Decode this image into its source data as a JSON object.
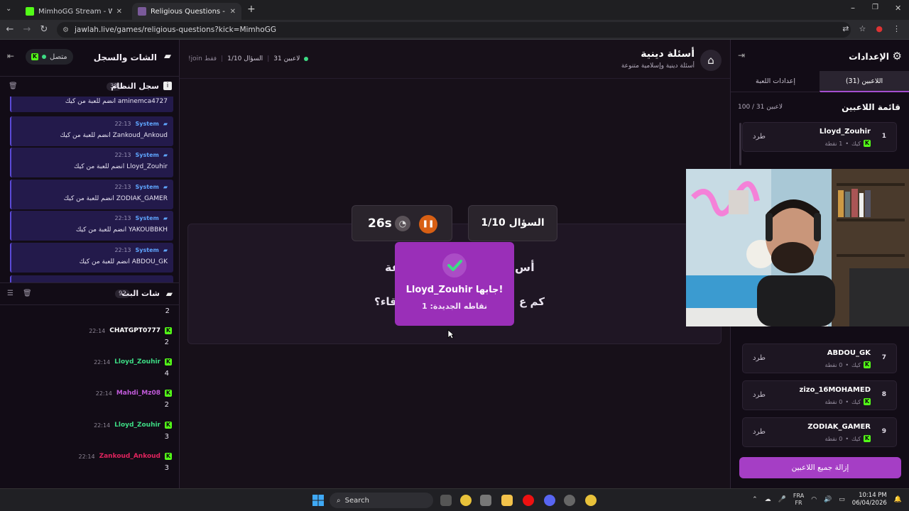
{
  "browser": {
    "tabs": [
      {
        "title": "MimhoGG Stream - Watch Live",
        "active": false
      },
      {
        "title": "Religious Questions - أسئلة دينية",
        "active": true
      }
    ],
    "url": "jawlah.live/games/religious-questions?kick=MimhoGG",
    "new_tab": "+",
    "close": "✕"
  },
  "left_panel": {
    "title": "الشات والسجل",
    "status": "متصل",
    "system_log": {
      "title": "سجل النظام",
      "count": "38",
      "partial_top": "aminemca4727 انضم للعبة من كيك",
      "entries": [
        {
          "time": "22:13",
          "source": "System",
          "message": "Zankoud_Ankoud انضم للعبة من كيك"
        },
        {
          "time": "22:13",
          "source": "System",
          "message": "Lloyd_Zouhir انضم للعبة من كيك"
        },
        {
          "time": "22:13",
          "source": "System",
          "message": "ZODIAK_GAMER انضم للعبة من كيك"
        },
        {
          "time": "22:13",
          "source": "System",
          "message": "YAKOUBBKH انضم للعبة من كيك"
        },
        {
          "time": "22:13",
          "source": "System",
          "message": "ABDOU_GK انضم للعبة من كيك"
        }
      ]
    },
    "stream_chat": {
      "title": "شات البث",
      "count": "92",
      "partial_top": "2",
      "messages": [
        {
          "time": "22:14",
          "user": "CHATGPT0777",
          "color": "#ffffff",
          "text": "2"
        },
        {
          "time": "22:14",
          "user": "Lloyd_Zouhir",
          "color": "#3ddc84",
          "text": "4"
        },
        {
          "time": "22:14",
          "user": "Mahdi_Mz08",
          "color": "#c05ad9",
          "text": "2"
        },
        {
          "time": "22:14",
          "user": "Lloyd_Zouhir",
          "color": "#3ddc84",
          "text": "3"
        },
        {
          "time": "22:14",
          "user": "Zankoud_Ankoud",
          "color": "#e0245e",
          "text": "3"
        }
      ]
    }
  },
  "main": {
    "title": "أسئلة دينية",
    "subtitle": "أسئلة دينية وإسلامية متنوعة",
    "status": {
      "players": "31 لاعبين",
      "question": "السؤال 1/10",
      "join_hint": "!join فقط"
    },
    "timer": "26s",
    "question_counter": "السؤال 1/10",
    "question_line1_start": "أس",
    "question_line1_end": "عة",
    "question_line2_start": "كم ع",
    "question_line2_end": "قاء؟",
    "popup": {
      "title": "Lloyd_Zouhir جابها!",
      "subtitle": "نقاطه الجديدة: 1"
    }
  },
  "right_panel": {
    "title": "الإعدادات",
    "tabs": {
      "players": "اللاعبين (31)",
      "game_settings": "إعدادات اللعبة"
    },
    "list_title": "قائمة اللاعبين",
    "list_count": "100 / 31 لاعبين",
    "kick_label": "طرد",
    "source": "كيك",
    "players": [
      {
        "rank": "1",
        "name": "Lloyd_Zouhir",
        "points": "1 نقطة"
      },
      {
        "rank": "7",
        "name": "ABDOU_GK",
        "points": "0 نقطة"
      },
      {
        "rank": "8",
        "name": "zizo_16MOHAMED",
        "points": "0 نقطة"
      },
      {
        "rank": "9",
        "name": "ZODIAK_GAMER",
        "points": "0 نقطة"
      }
    ],
    "clear_button": "إزالة جميع اللاعبين"
  },
  "taskbar": {
    "search": "Search",
    "lang": "FRA\nFR",
    "time": "10:14 PM",
    "date": "06/04/2026"
  },
  "colors": {
    "accent": "#a53ec5",
    "kick_green": "#53fc18",
    "system_blue": "#5fa6ff"
  }
}
